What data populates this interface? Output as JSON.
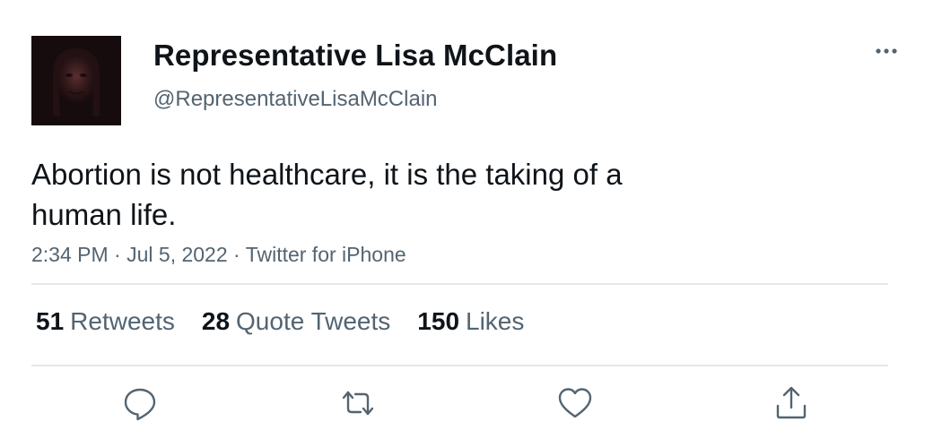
{
  "author": {
    "display_name": "Representative Lisa McClain",
    "handle": "@RepresentativeLisaMcClain"
  },
  "tweet": {
    "text": "Abortion is not healthcare, it is the taking of a human life.",
    "time": "2:34 PM",
    "separator": "·",
    "date": "Jul 5, 2022",
    "source": "Twitter for iPhone"
  },
  "stats": [
    {
      "count": "51",
      "label": "Retweets"
    },
    {
      "count": "28",
      "label": "Quote Tweets"
    },
    {
      "count": "150",
      "label": "Likes"
    }
  ],
  "icons": {
    "more": "more-horizontal-icon",
    "reply": "reply-icon",
    "retweet": "retweet-icon",
    "like": "heart-icon",
    "share": "share-icon"
  },
  "colors": {
    "text": "#0f1419",
    "secondary": "#536471",
    "divider": "#e5e7e9",
    "icon": "#536471"
  }
}
